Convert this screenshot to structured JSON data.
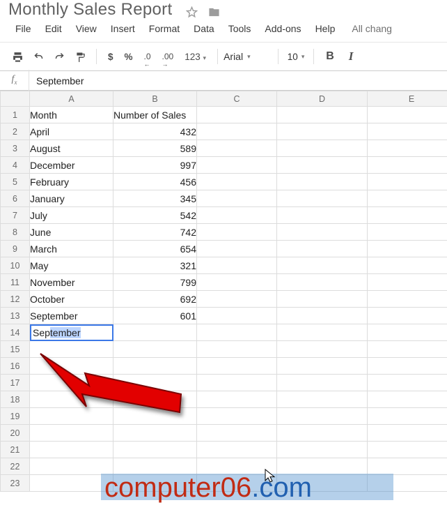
{
  "doc": {
    "title": "Monthly Sales Report"
  },
  "menu": {
    "file": "File",
    "edit": "Edit",
    "view": "View",
    "insert": "Insert",
    "format": "Format",
    "data": "Data",
    "tools": "Tools",
    "addons": "Add-ons",
    "help": "Help",
    "changes": "All chang"
  },
  "toolbar": {
    "currency": "$",
    "percent": "%",
    "dec_dec": ".0",
    "dec_inc": ".00",
    "more_formats": "123",
    "font": "Arial",
    "size": "10",
    "bold": "B",
    "italic": "I"
  },
  "formula": {
    "label": "fx",
    "value": "September"
  },
  "columns": [
    "A",
    "B",
    "C",
    "D",
    "E"
  ],
  "chart_data": {
    "type": "table",
    "title": "Monthly Sales Report",
    "headers": [
      "Month",
      "Number of Sales"
    ],
    "rows": [
      [
        "April",
        432
      ],
      [
        "August",
        589
      ],
      [
        "December",
        997
      ],
      [
        "February",
        456
      ],
      [
        "January",
        345
      ],
      [
        "July",
        542
      ],
      [
        "June",
        742
      ],
      [
        "March",
        654
      ],
      [
        "May",
        321
      ],
      [
        "November",
        799
      ],
      [
        "October",
        692
      ],
      [
        "September",
        601
      ]
    ]
  },
  "editing": {
    "row": 14,
    "prefix": "Sep",
    "suffix": "tember"
  },
  "blank_rows": 9,
  "watermark": {
    "host": "computer06",
    "tld": ".com"
  }
}
